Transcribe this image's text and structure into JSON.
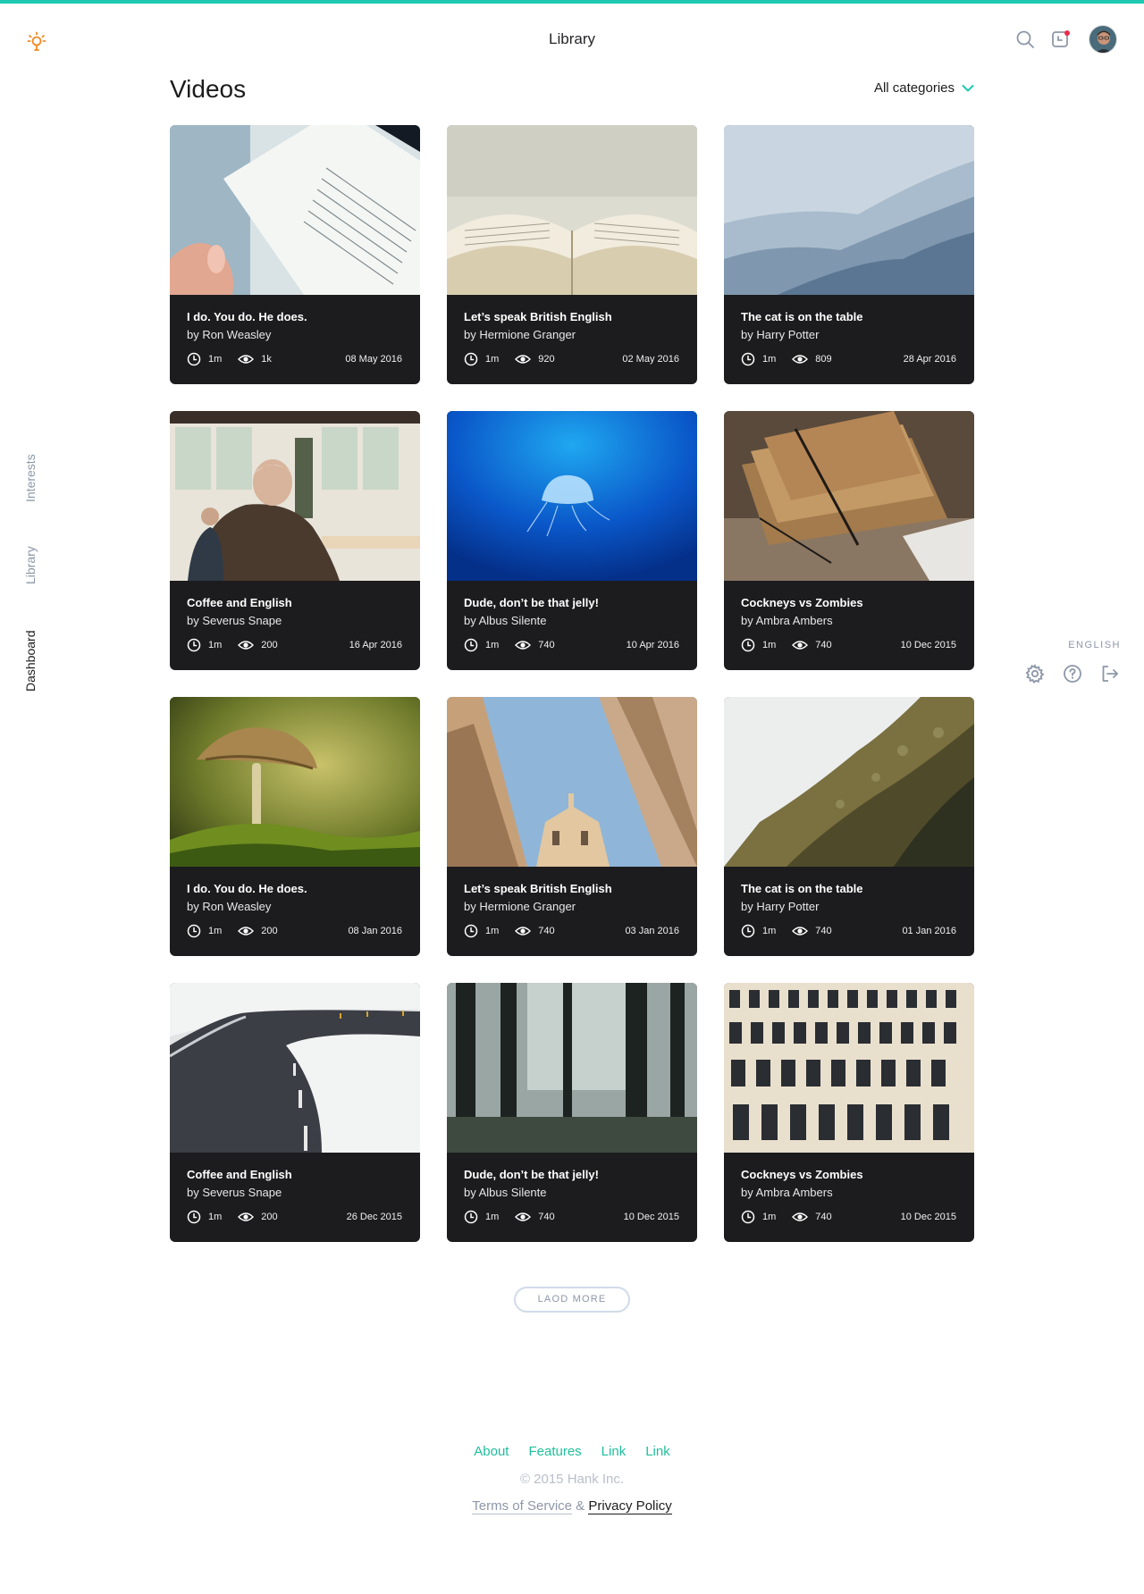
{
  "header": {
    "title": "Library"
  },
  "side_nav": {
    "items": [
      {
        "label": "Interests"
      },
      {
        "label": "Library"
      },
      {
        "label": "Dashboard"
      }
    ]
  },
  "right_tools": {
    "language": "ENGLISH"
  },
  "main": {
    "section_title": "Videos",
    "category_select": "All categories"
  },
  "cards": [
    {
      "title": "I do. You do. He does.",
      "author": "by Ron Weasley",
      "duration": "1m",
      "views": "1k",
      "date": "08 May 2016"
    },
    {
      "title": "Let’s speak British English",
      "author": "by Hermione Granger",
      "duration": "1m",
      "views": "920",
      "date": "02 May 2016"
    },
    {
      "title": "The cat is on the table",
      "author": "by Harry Potter",
      "duration": "1m",
      "views": "809",
      "date": "28 Apr 2016"
    },
    {
      "title": "Coffee and English",
      "author": "by Severus Snape",
      "duration": "1m",
      "views": "200",
      "date": "16 Apr 2016"
    },
    {
      "title": "Dude, don’t be that jelly!",
      "author": "by Albus Silente",
      "duration": "1m",
      "views": "740",
      "date": "10 Apr 2016"
    },
    {
      "title": "Cockneys vs Zombies",
      "author": "by Ambra Ambers",
      "duration": "1m",
      "views": "740",
      "date": "10 Dec 2015"
    },
    {
      "title": "I do. You do. He does.",
      "author": "by Ron Weasley",
      "duration": "1m",
      "views": "200",
      "date": "08 Jan 2016"
    },
    {
      "title": "Let’s speak British English",
      "author": "by Hermione Granger",
      "duration": "1m",
      "views": "740",
      "date": "03 Jan 2016"
    },
    {
      "title": "The cat is on the table",
      "author": "by Harry Potter",
      "duration": "1m",
      "views": "740",
      "date": "01 Jan 2016"
    },
    {
      "title": "Coffee and English",
      "author": "by Severus Snape",
      "duration": "1m",
      "views": "200",
      "date": "26 Dec 2015"
    },
    {
      "title": "Dude, don’t be that jelly!",
      "author": "by Albus Silente",
      "duration": "1m",
      "views": "740",
      "date": "10 Dec 2015"
    },
    {
      "title": "Cockneys vs Zombies",
      "author": "by Ambra Ambers",
      "duration": "1m",
      "views": "740",
      "date": "10 Dec 2015"
    }
  ],
  "load_more": "LAOD MORE",
  "footer": {
    "links": [
      "About",
      "Features",
      "Link",
      "Link"
    ],
    "copyright": "© 2015 Hank Inc.",
    "terms": "Terms of Service",
    "amp": " & ",
    "privacy": "Privacy Policy"
  },
  "colors": {
    "accent": "#1fc8b0",
    "link": "#1fbf9c",
    "card_bg": "#1c1c1e",
    "muted": "#8d97a8"
  }
}
